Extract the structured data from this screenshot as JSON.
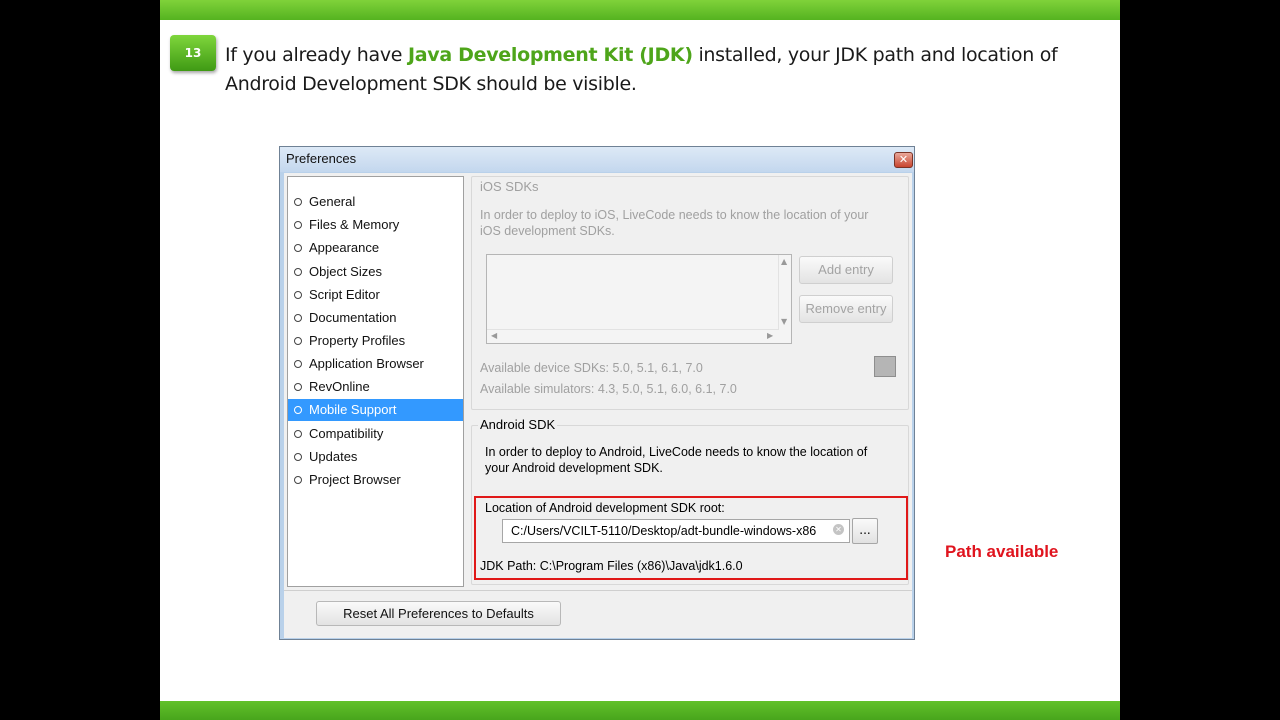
{
  "slide": {
    "step_number": "13",
    "instruction_before": "If you already have ",
    "instruction_highlight": "Java Development Kit (JDK)",
    "instruction_after": " installed, your JDK path and location of Android Development SDK should be visible.",
    "callout": "Path available"
  },
  "window": {
    "title": "Preferences",
    "close_icon": "close-x-icon"
  },
  "nav": {
    "items": [
      {
        "label": "General"
      },
      {
        "label": "Files & Memory"
      },
      {
        "label": "Appearance"
      },
      {
        "label": "Object Sizes"
      },
      {
        "label": "Script Editor"
      },
      {
        "label": "Documentation"
      },
      {
        "label": "Property Profiles"
      },
      {
        "label": "Application Browser"
      },
      {
        "label": "RevOnline"
      },
      {
        "label": "Mobile Support"
      },
      {
        "label": "Compatibility"
      },
      {
        "label": "Updates"
      },
      {
        "label": "Project Browser"
      }
    ],
    "selected": "Mobile Support"
  },
  "ios": {
    "group_label": "iOS SDKs",
    "description": "In order to deploy to iOS, LiveCode needs to know the location of your iOS development SDKs.",
    "add_entry": "Add entry",
    "remove_entry": "Remove entry",
    "available_device_sdks": "Available device SDKs: 5.0, 5.1, 6.1, 7.0",
    "available_simulators": "Available simulators: 4.3, 5.0, 5.1, 6.0, 6.1, 7.0"
  },
  "android": {
    "group_label": "Android SDK",
    "description": "In order to deploy to Android, LiveCode needs to know the location of your Android development SDK.",
    "location_label": "Location of Android development SDK root:",
    "sdk_path": "C:/Users/VCILT-5110/Desktop/adt-bundle-windows-x86",
    "browse_label": "...",
    "jdk_path": "JDK Path: C:\\Program Files (x86)\\Java\\jdk1.6.0"
  },
  "footer": {
    "reset_button": "Reset All Preferences to Defaults"
  },
  "colors": {
    "green_accent": "#4ea51a",
    "selection_blue": "#3399ff",
    "highlight_red": "#e01818"
  }
}
